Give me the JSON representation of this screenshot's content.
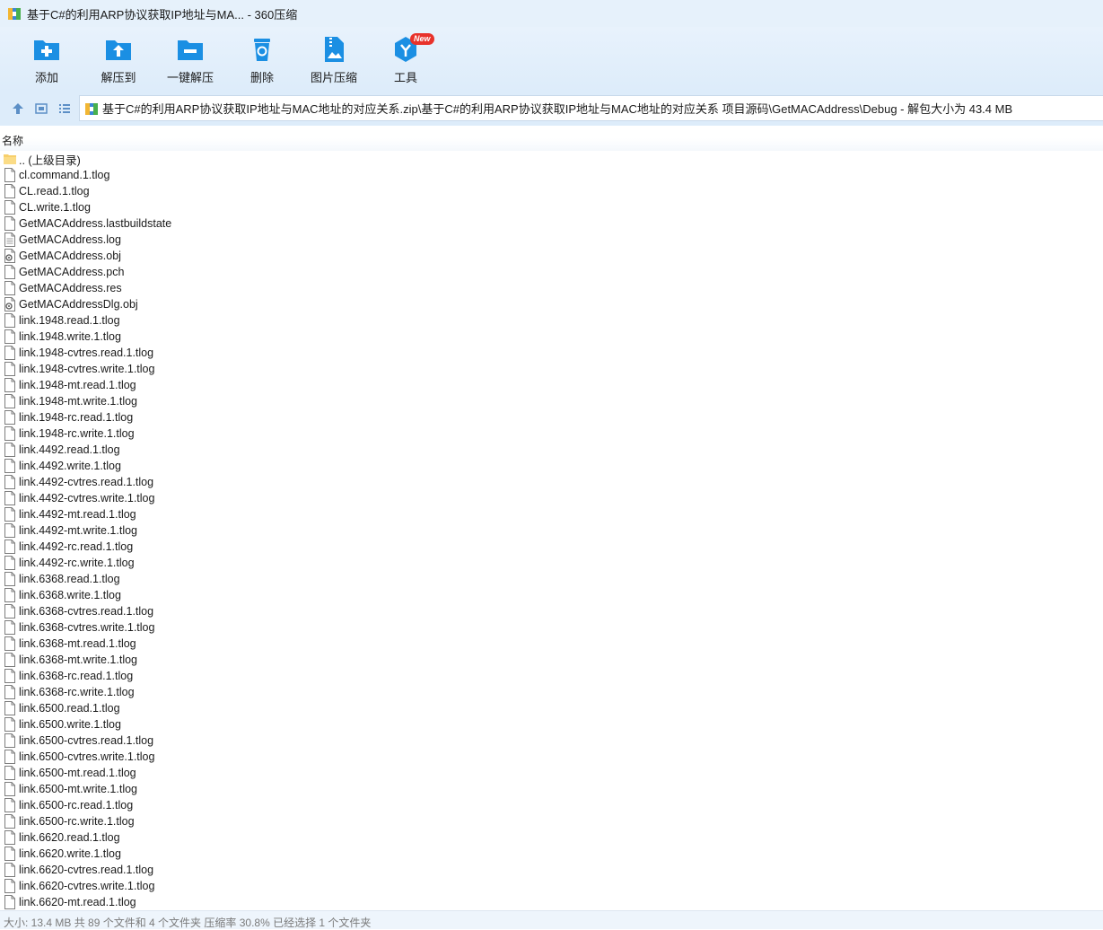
{
  "window": {
    "title": "基于C#的利用ARP协议获取IP地址与MA... - 360压缩",
    "app_icon": "archive-app-icon"
  },
  "toolbar": {
    "buttons": [
      {
        "label": "添加",
        "icon": "add-folder-icon"
      },
      {
        "label": "解压到",
        "icon": "extract-to-icon"
      },
      {
        "label": "一键解压",
        "icon": "one-click-extract-icon"
      },
      {
        "label": "删除",
        "icon": "trash-icon"
      },
      {
        "label": "图片压缩",
        "icon": "image-compress-icon"
      },
      {
        "label": "工具",
        "icon": "tools-icon",
        "badge": "New"
      }
    ]
  },
  "addressbar": {
    "path": "基于C#的利用ARP协议获取IP地址与MAC地址的对应关系.zip\\基于C#的利用ARP协议获取IP地址与MAC地址的对应关系 项目源码\\GetMACAddress\\Debug - 解包大小为 43.4 MB"
  },
  "list": {
    "column_name": "名称",
    "items": [
      {
        "name": ".. (上级目录)",
        "type": "folder"
      },
      {
        "name": "cl.command.1.tlog",
        "type": "file"
      },
      {
        "name": "CL.read.1.tlog",
        "type": "file"
      },
      {
        "name": "CL.write.1.tlog",
        "type": "file"
      },
      {
        "name": "GetMACAddress.lastbuildstate",
        "type": "file"
      },
      {
        "name": "GetMACAddress.log",
        "type": "text"
      },
      {
        "name": "GetMACAddress.obj",
        "type": "obj"
      },
      {
        "name": "GetMACAddress.pch",
        "type": "file"
      },
      {
        "name": "GetMACAddress.res",
        "type": "file"
      },
      {
        "name": "GetMACAddressDlg.obj",
        "type": "obj"
      },
      {
        "name": "link.1948.read.1.tlog",
        "type": "file"
      },
      {
        "name": "link.1948.write.1.tlog",
        "type": "file"
      },
      {
        "name": "link.1948-cvtres.read.1.tlog",
        "type": "file"
      },
      {
        "name": "link.1948-cvtres.write.1.tlog",
        "type": "file"
      },
      {
        "name": "link.1948-mt.read.1.tlog",
        "type": "file"
      },
      {
        "name": "link.1948-mt.write.1.tlog",
        "type": "file"
      },
      {
        "name": "link.1948-rc.read.1.tlog",
        "type": "file"
      },
      {
        "name": "link.1948-rc.write.1.tlog",
        "type": "file"
      },
      {
        "name": "link.4492.read.1.tlog",
        "type": "file"
      },
      {
        "name": "link.4492.write.1.tlog",
        "type": "file"
      },
      {
        "name": "link.4492-cvtres.read.1.tlog",
        "type": "file"
      },
      {
        "name": "link.4492-cvtres.write.1.tlog",
        "type": "file"
      },
      {
        "name": "link.4492-mt.read.1.tlog",
        "type": "file"
      },
      {
        "name": "link.4492-mt.write.1.tlog",
        "type": "file"
      },
      {
        "name": "link.4492-rc.read.1.tlog",
        "type": "file"
      },
      {
        "name": "link.4492-rc.write.1.tlog",
        "type": "file"
      },
      {
        "name": "link.6368.read.1.tlog",
        "type": "file"
      },
      {
        "name": "link.6368.write.1.tlog",
        "type": "file"
      },
      {
        "name": "link.6368-cvtres.read.1.tlog",
        "type": "file"
      },
      {
        "name": "link.6368-cvtres.write.1.tlog",
        "type": "file"
      },
      {
        "name": "link.6368-mt.read.1.tlog",
        "type": "file"
      },
      {
        "name": "link.6368-mt.write.1.tlog",
        "type": "file"
      },
      {
        "name": "link.6368-rc.read.1.tlog",
        "type": "file"
      },
      {
        "name": "link.6368-rc.write.1.tlog",
        "type": "file"
      },
      {
        "name": "link.6500.read.1.tlog",
        "type": "file"
      },
      {
        "name": "link.6500.write.1.tlog",
        "type": "file"
      },
      {
        "name": "link.6500-cvtres.read.1.tlog",
        "type": "file"
      },
      {
        "name": "link.6500-cvtres.write.1.tlog",
        "type": "file"
      },
      {
        "name": "link.6500-mt.read.1.tlog",
        "type": "file"
      },
      {
        "name": "link.6500-mt.write.1.tlog",
        "type": "file"
      },
      {
        "name": "link.6500-rc.read.1.tlog",
        "type": "file"
      },
      {
        "name": "link.6500-rc.write.1.tlog",
        "type": "file"
      },
      {
        "name": "link.6620.read.1.tlog",
        "type": "file"
      },
      {
        "name": "link.6620.write.1.tlog",
        "type": "file"
      },
      {
        "name": "link.6620-cvtres.read.1.tlog",
        "type": "file"
      },
      {
        "name": "link.6620-cvtres.write.1.tlog",
        "type": "file"
      },
      {
        "name": "link.6620-mt.read.1.tlog",
        "type": "file"
      }
    ]
  },
  "statusbar": {
    "text": "大小: 13.4 MB 共 89 个文件和 4 个文件夹 压缩率 30.8% 已经选择 1 个文件夹"
  },
  "colors": {
    "accent": "#1b8fe3",
    "toolbar_bg": "#ddecfa",
    "badge": "#e8322b"
  }
}
